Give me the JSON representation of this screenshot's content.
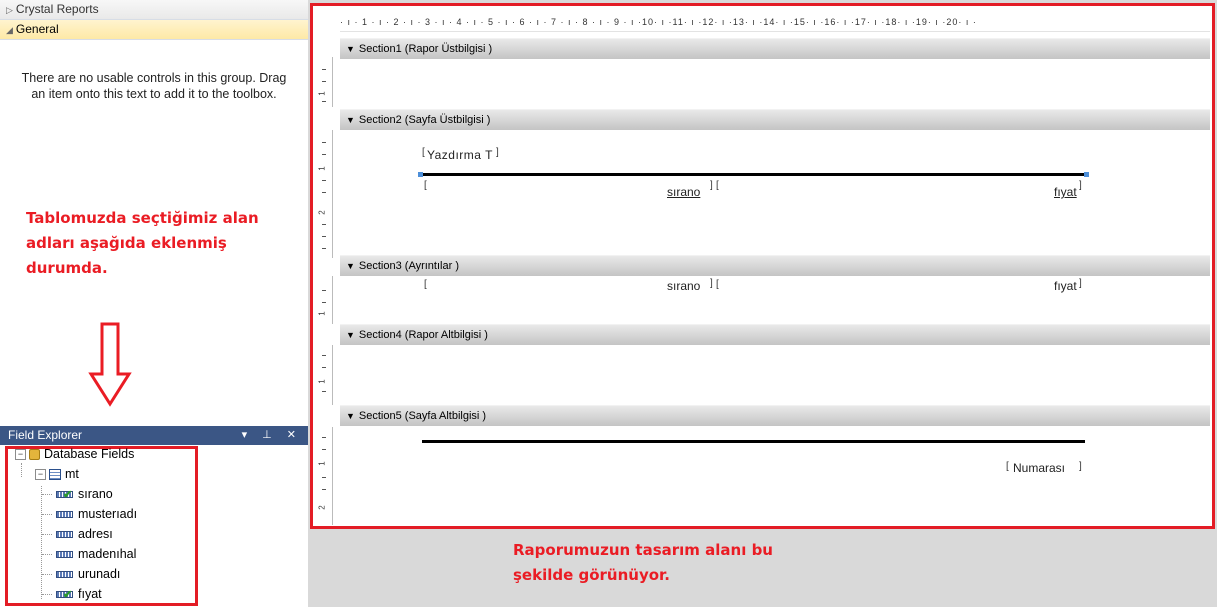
{
  "toolbox": {
    "groups": [
      {
        "label": "Crystal Reports",
        "state": "collapsed"
      },
      {
        "label": "General",
        "state": "expanded"
      }
    ],
    "empty_message": "There are no usable controls in this group. Drag an item onto this text to add it to the toolbox."
  },
  "annotations": {
    "left": "Tablomuzda seçtiğimiz alan adları aşağıda eklenmiş durumda.",
    "bottom": "Raporumuzun tasarım alanı bu şekilde görünüyor.",
    "color": "#ea1c24"
  },
  "field_explorer": {
    "title": "Field Explorer",
    "controls": "▾ ⊥ ✕",
    "root": "Database Fields",
    "table": "mt",
    "fields": [
      {
        "name": "sırano",
        "used": true
      },
      {
        "name": "musterıadı",
        "used": false
      },
      {
        "name": "adresı",
        "used": false
      },
      {
        "name": "madenıhal",
        "used": false
      },
      {
        "name": "urunadı",
        "used": false
      },
      {
        "name": "fıyat",
        "used": true
      }
    ]
  },
  "design": {
    "ruler": "· ı · 1 · ı · 2 · ı · 3 · ı · 4 · ı · 5 · ı · 6 · ı · 7 · ı · 8 · ı · 9 · ı ·10· ı ·11· ı ·12· ı ·13· ı ·14· ı ·15· ı ·16· ı ·17· ı ·18· ı ·19· ı ·20· ı ·",
    "sections": [
      {
        "label": "Section1 (Rapor Üstbilgisi )"
      },
      {
        "label": "Section2 (Sayfa Üstbilgisi )"
      },
      {
        "label": "Section3 (Ayrıntılar )"
      },
      {
        "label": "Section4 (Rapor Altbilgisi )"
      },
      {
        "label": "Section5 (Sayfa Altbilgisi )"
      }
    ],
    "print_date_text": "Yazdırma T",
    "header_sirano": "sırano",
    "header_fiyat": "fıyat",
    "detail_sirano": "sırano",
    "detail_fiyat": "fıyat",
    "page_number": "Numarası"
  }
}
